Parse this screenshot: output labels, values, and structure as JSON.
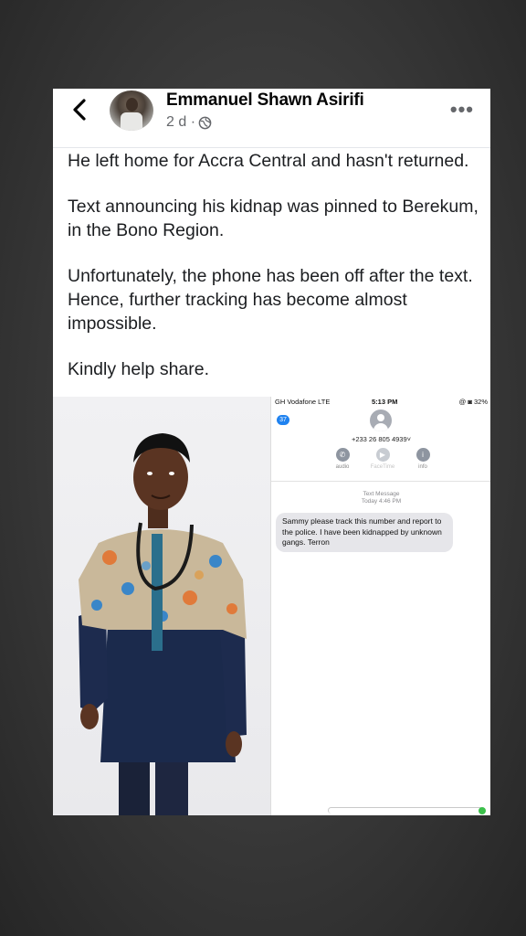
{
  "post": {
    "author": "Emmanuel Shawn Asirifi",
    "time": "2 d ·",
    "more_label": "•••",
    "paragraphs": [
      "He left home for Accra Central and hasn't returned.",
      "Text announcing his kidnap was pinned to Berekum, in the Bono Region.",
      "Unfortunately, the phone has been off after the text. Hence, further tracking has become almost impossible.",
      "Kindly help share."
    ]
  },
  "phone": {
    "carrier": "GH Vodafone  LTE",
    "time": "5:13 PM",
    "battery": "@ ◙ 32%",
    "badge": "37",
    "number": "+233 26 805 4939˅",
    "actions": [
      "audio",
      "FaceTime",
      "info"
    ],
    "message_label": "Text Message",
    "message_time": "Today 4:46 PM",
    "message": "Sammy please track this number and report to the police. I have been kidnapped by unknown gangs. Terron"
  },
  "colors": {
    "name_text": "#050505",
    "meta_text": "#65676b",
    "imessage_blue": "#1f82f0",
    "bubble_gray": "#e6e6ea"
  },
  "icons": [
    "back-chevron-icon",
    "globe-icon",
    "more-icon",
    "phone-icon",
    "video-icon",
    "info-icon",
    "contact-icon"
  ]
}
